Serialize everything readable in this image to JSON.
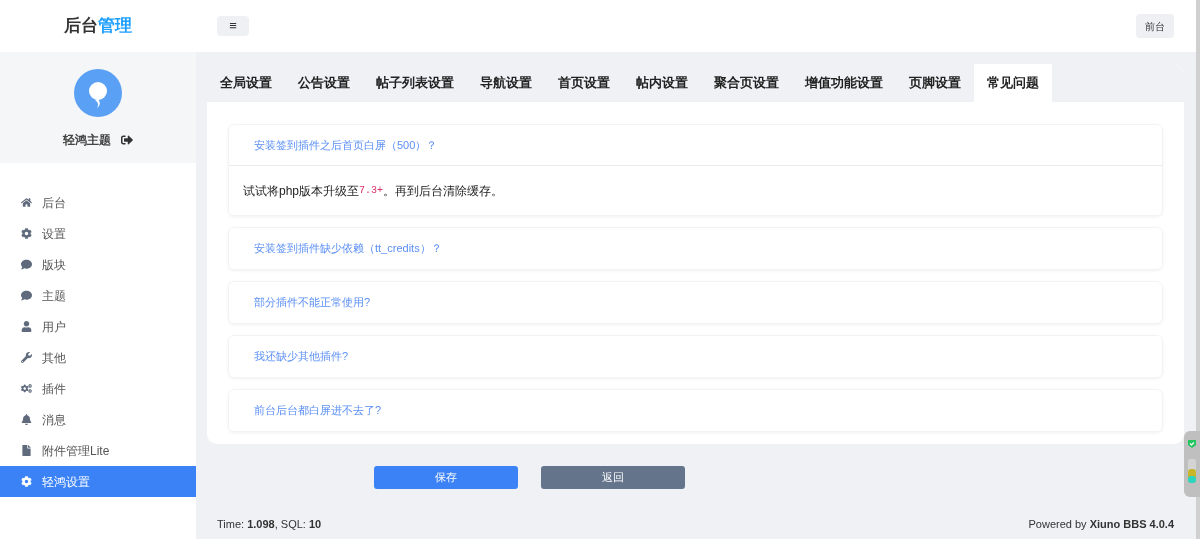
{
  "header": {
    "logo": {
      "part1": "后台",
      "part2": "管理"
    },
    "menu_toggle": "≡",
    "front_button": "前台"
  },
  "sidebar": {
    "user": {
      "name": "轻鸿主题"
    },
    "items": [
      {
        "label": "后台",
        "selected": false
      },
      {
        "label": "设置",
        "selected": false
      },
      {
        "label": "版块",
        "selected": false
      },
      {
        "label": "主题",
        "selected": false
      },
      {
        "label": "用户",
        "selected": false
      },
      {
        "label": "其他",
        "selected": false
      },
      {
        "label": "插件",
        "selected": false
      },
      {
        "label": "消息",
        "selected": false
      },
      {
        "label": "附件管理Lite",
        "selected": false
      },
      {
        "label": "轻鸿设置",
        "selected": true
      }
    ]
  },
  "tabs": [
    {
      "label": "全局设置",
      "selected": false
    },
    {
      "label": "公告设置",
      "selected": false
    },
    {
      "label": "帖子列表设置",
      "selected": false
    },
    {
      "label": "导航设置",
      "selected": false
    },
    {
      "label": "首页设置",
      "selected": false
    },
    {
      "label": "帖内设置",
      "selected": false
    },
    {
      "label": "聚合页设置",
      "selected": false
    },
    {
      "label": "增值功能设置",
      "selected": false
    },
    {
      "label": "页脚设置",
      "selected": false
    },
    {
      "label": "常见问题",
      "selected": true
    }
  ],
  "faq": [
    {
      "question": "安装签到插件之后首页白屏（500）？",
      "expanded": true,
      "answer": {
        "before": "试试将php版本升级至",
        "code": "7.3+",
        "after": "。再到后台清除缓存。"
      }
    },
    {
      "question": "安装签到插件缺少依赖（tt_credits）？",
      "expanded": false
    },
    {
      "question": "部分插件不能正常使用?",
      "expanded": false
    },
    {
      "question": "我还缺少其他插件?",
      "expanded": false
    },
    {
      "question": "前台后台都白屏进不去了?",
      "expanded": false
    }
  ],
  "buttons": {
    "save": "保存",
    "back": "返回"
  },
  "footer": {
    "stats": "Time: **1.098**, SQL: **10**",
    "powered": "Powered by **Xiuno BBS 4.0.4**"
  }
}
